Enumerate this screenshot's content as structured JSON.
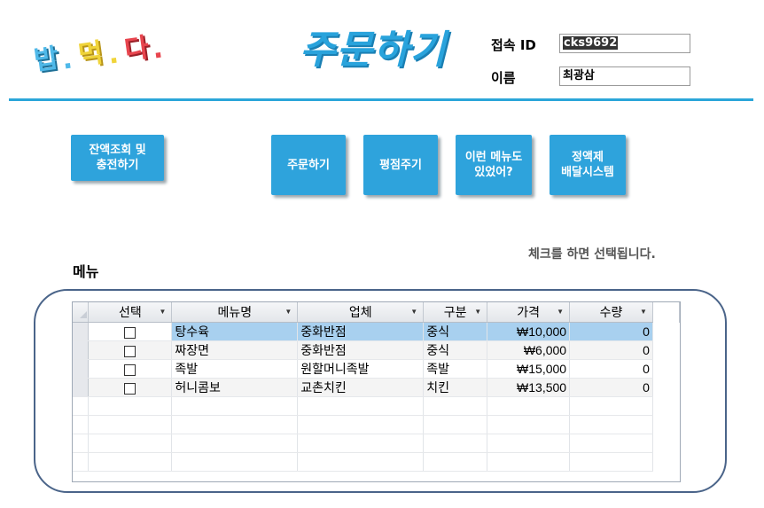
{
  "logo": {
    "chars": [
      "밥",
      "먹",
      "다"
    ],
    "dots": [
      ".",
      ".",
      "."
    ],
    "colors": [
      "#4fb9e9",
      "#f0d43a",
      "#e8454e"
    ]
  },
  "page_title": "주문하기",
  "user": {
    "id_label": "접속 ID",
    "id_value": "cks9692",
    "name_label": "이름",
    "name_value": "최광삼"
  },
  "buttons": {
    "balance": "잔액조회 및\n충전하기",
    "order": "주문하기",
    "review": "평점주기",
    "suggest": "이런 메뉴도\n있었어?",
    "subscription": "정액제\n배달시스템"
  },
  "hint_text": "체크를 하면 선택됩니다.",
  "menu_title": "메뉴",
  "grid": {
    "columns": [
      "선택",
      "메뉴명",
      "업체",
      "구분",
      "가격",
      "수량"
    ],
    "rows": [
      {
        "menu": "탕수육",
        "store": "중화반점",
        "category": "중식",
        "price": "₩10,000",
        "qty": "0"
      },
      {
        "menu": "짜장면",
        "store": "중화반점",
        "category": "중식",
        "price": "₩6,000",
        "qty": "0"
      },
      {
        "menu": "족발",
        "store": "원할머니족발",
        "category": "족발",
        "price": "₩15,000",
        "qty": "0"
      },
      {
        "menu": "허니콤보",
        "store": "교촌치킨",
        "category": "치킨",
        "price": "₩13,500",
        "qty": "0"
      }
    ]
  },
  "accent_color": "#2ea3dc"
}
